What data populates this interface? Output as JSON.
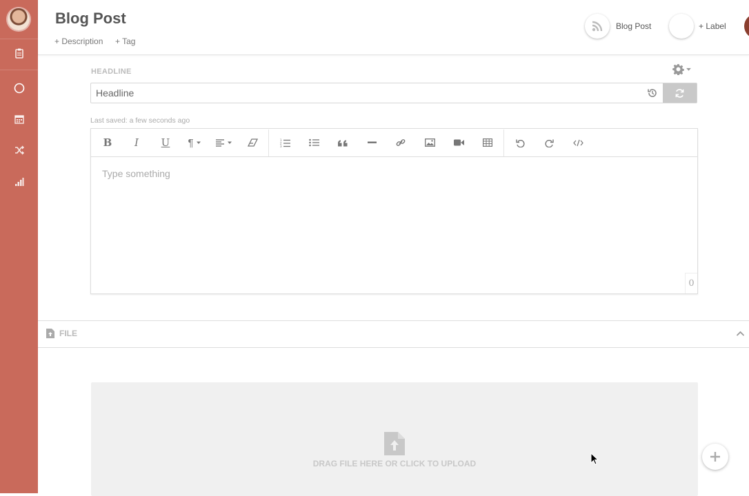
{
  "header": {
    "title": "Blog Post",
    "add_description": "+ Description",
    "add_tag": "+ Tag",
    "badges": [
      {
        "icon": "rss-icon",
        "label": "Blog Post"
      },
      {
        "icon": "empty-circle",
        "label": "+ Label"
      }
    ]
  },
  "sidebar": {
    "items": [
      {
        "icon": "clipboard-icon"
      },
      {
        "icon": "circle-icon"
      },
      {
        "icon": "calendar-icon"
      },
      {
        "icon": "shuffle-icon"
      },
      {
        "icon": "bar-chart-icon"
      }
    ],
    "color": "#c96a5b"
  },
  "headline": {
    "label": "HEADLINE",
    "placeholder": "Headline",
    "value": ""
  },
  "last_saved": "Last saved: a few seconds ago",
  "editor": {
    "placeholder": "Type something",
    "char_count": "0",
    "toolbar": [
      "bold",
      "italic",
      "underline",
      "paragraph",
      "align",
      "eraser",
      "ordered-list",
      "unordered-list",
      "quote",
      "horizontal-rule",
      "link",
      "image",
      "video",
      "table",
      "undo",
      "redo",
      "code-view"
    ]
  },
  "file_section": {
    "title": "FILE",
    "dropzone_text": "DRAG FILE HERE OR CLICK TO UPLOAD"
  }
}
